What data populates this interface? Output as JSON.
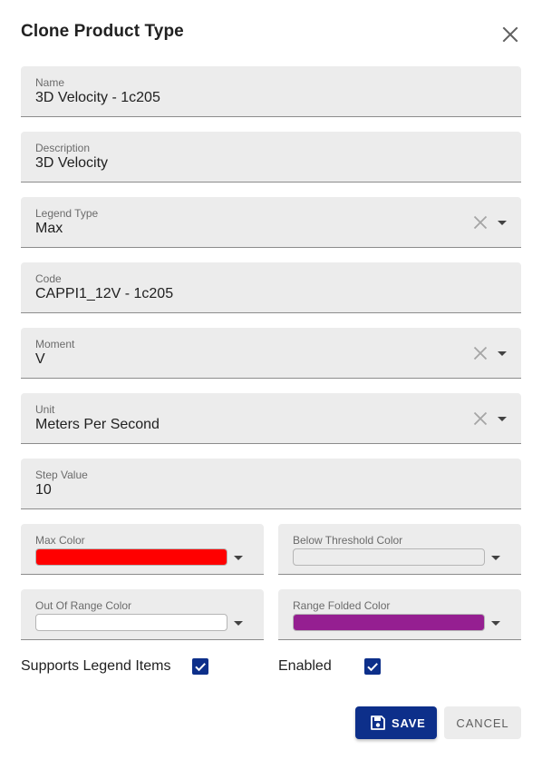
{
  "dialog": {
    "title": "Clone Product Type",
    "close_icon": "close-icon"
  },
  "fields": {
    "name": {
      "label": "Name",
      "value": "3D Velocity - 1c205"
    },
    "description": {
      "label": "Description",
      "value": "3D Velocity"
    },
    "legend_type": {
      "label": "Legend Type",
      "value": "Max"
    },
    "code": {
      "label": "Code",
      "value": "CAPPI1_12V - 1c205"
    },
    "moment": {
      "label": "Moment",
      "value": "V"
    },
    "unit": {
      "label": "Unit",
      "value": "Meters Per Second"
    },
    "step_value": {
      "label": "Step Value",
      "value": "10"
    }
  },
  "colors": {
    "max_color": {
      "label": "Max Color",
      "color": "#ff0000"
    },
    "below_threshold_color": {
      "label": "Below Threshold Color",
      "color": "#ececec"
    },
    "out_of_range_color": {
      "label": "Out Of Range Color",
      "color": "#ffffff"
    },
    "range_folded_color": {
      "label": "Range Folded Color",
      "color": "#951f91"
    }
  },
  "checkboxes": {
    "supports_legend_items": {
      "label": "Supports Legend Items",
      "checked": true
    },
    "enabled": {
      "label": "Enabled",
      "checked": true
    }
  },
  "buttons": {
    "save": "SAVE",
    "cancel": "CANCEL"
  },
  "theme": {
    "accent": "#0d2f8a",
    "field_bg": "#ececec"
  }
}
